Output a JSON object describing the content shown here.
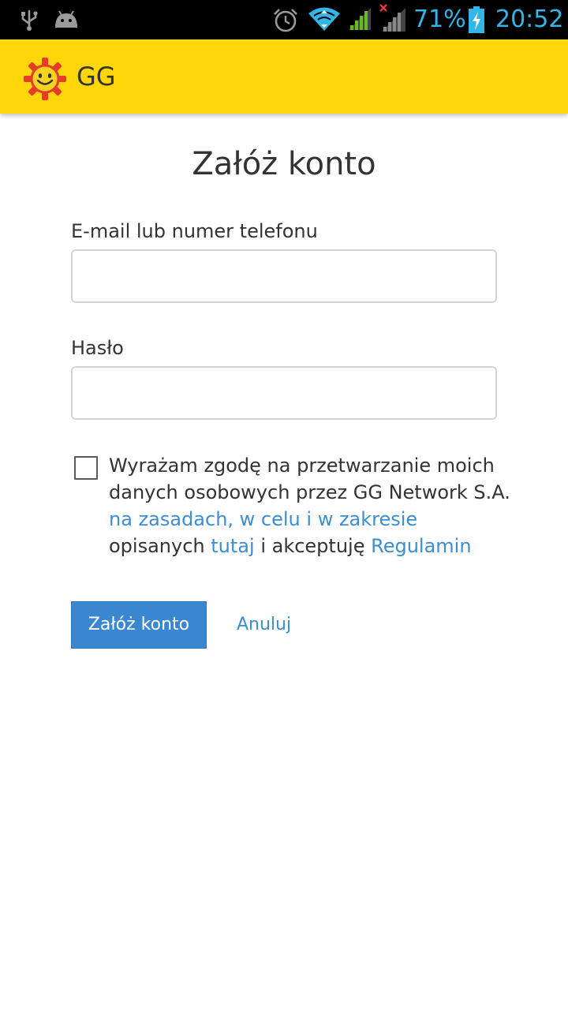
{
  "status_bar": {
    "icons": [
      "usb-icon",
      "android-icon",
      "alarm-icon",
      "wifi-icon",
      "signal-icon",
      "signal-no-data-icon",
      "battery-charging-icon"
    ],
    "battery": "71%",
    "time": "20:52",
    "colors": {
      "background": "#000000",
      "icon": "#33b5e5"
    }
  },
  "app_bar": {
    "title": "GG",
    "logo": "gg-sun-logo",
    "background": "#ffd60a"
  },
  "form": {
    "title": "Załóż konto",
    "email_label": "E-mail lub numer telefonu",
    "email_value": "",
    "password_label": "Hasło",
    "password_value": "",
    "consent": {
      "checked": false,
      "text_1": "Wyrażam zgodę na przetwarzanie moich danych osobowych przez GG Network S.A.",
      "link_1": "na zasadach, w celu i w zakresie",
      "text_2": "opisanych",
      "link_2": "tutaj",
      "text_3": "i akceptuję",
      "link_3": "Regulamin"
    },
    "submit_label": "Załóż konto",
    "cancel_label": "Anuluj",
    "accent": "#3b87cf"
  }
}
